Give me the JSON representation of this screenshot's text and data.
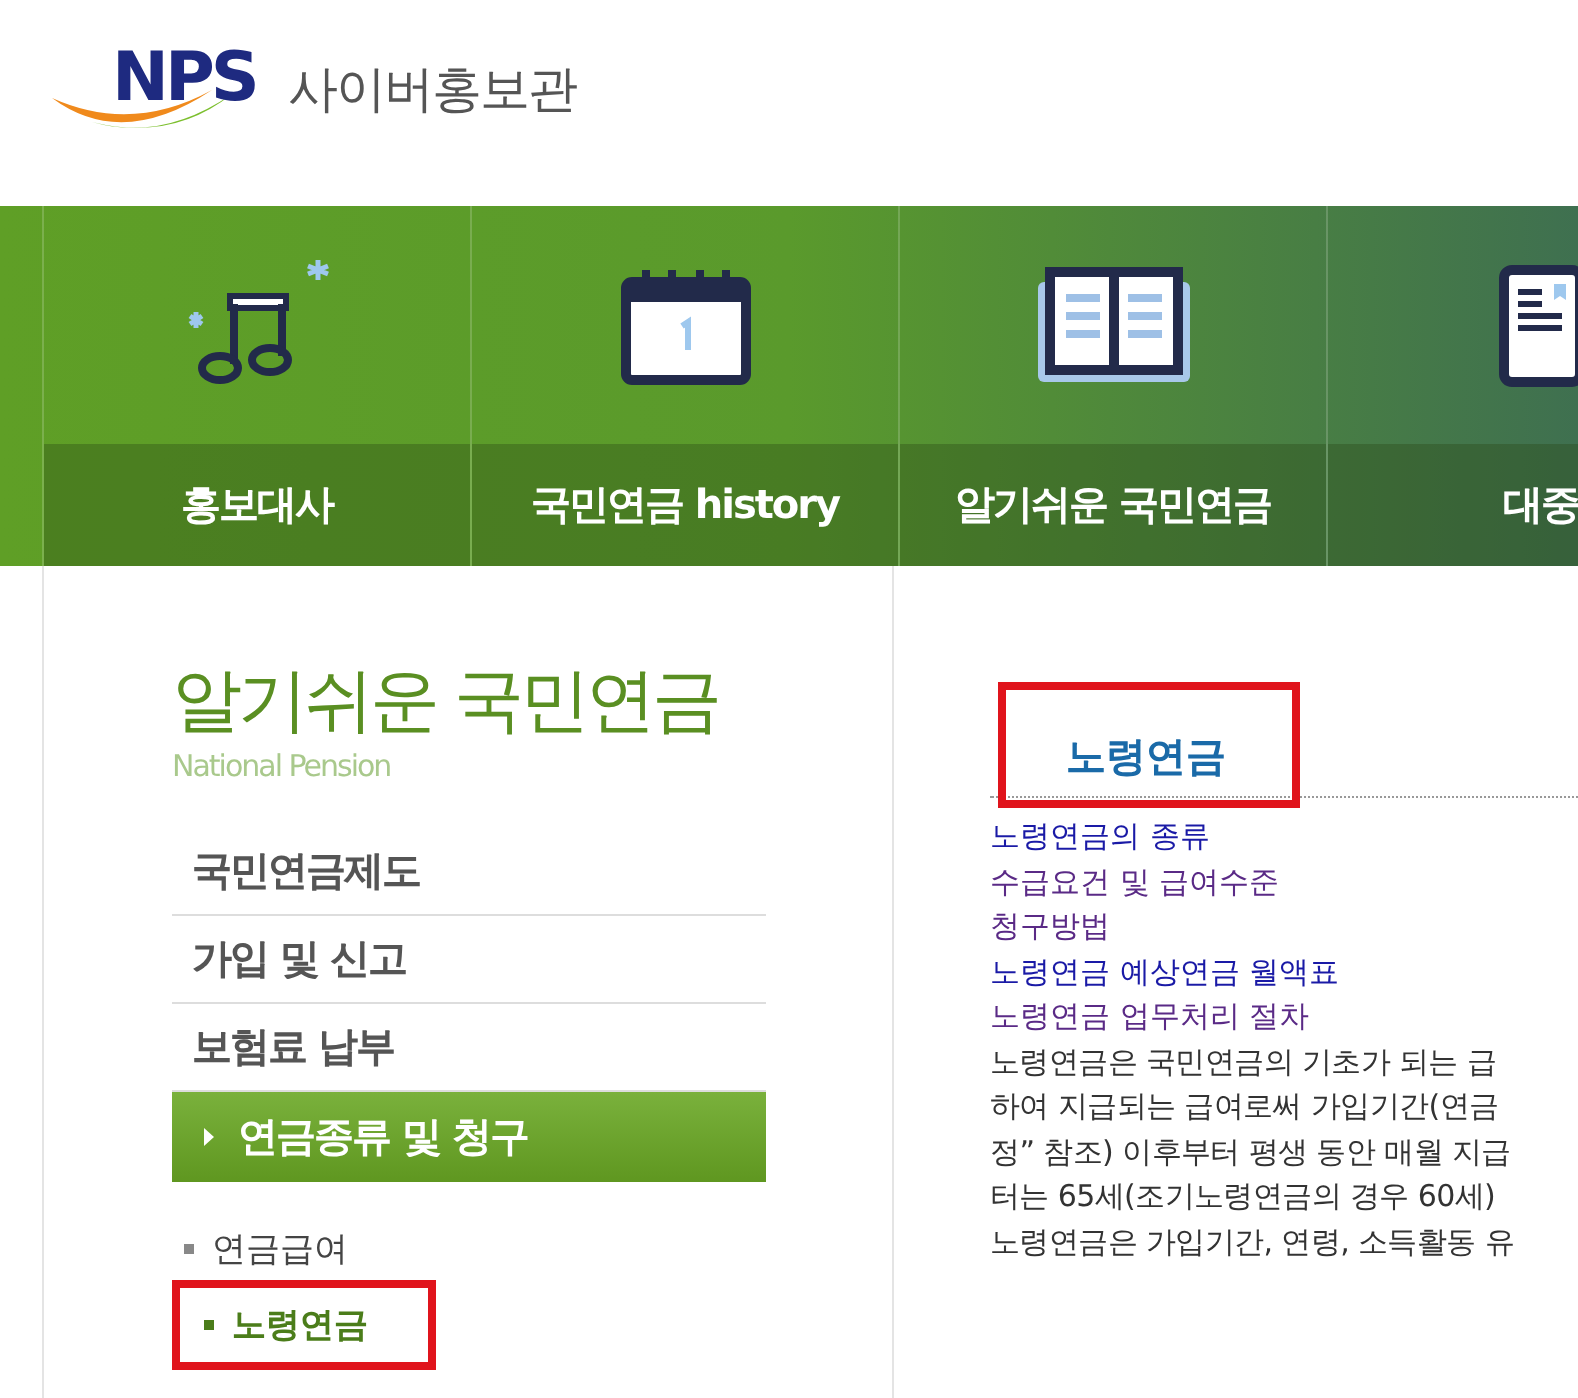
{
  "logo": {
    "mark": "NPS",
    "title": "사이버홍보관"
  },
  "nav": [
    {
      "label": "홍보대사",
      "kind": "music"
    },
    {
      "label": "국민연금 history",
      "kind": "calendar"
    },
    {
      "label": "알기쉬운 국민연금",
      "kind": "book"
    },
    {
      "label": "대중",
      "kind": "tablet"
    }
  ],
  "sidebar": {
    "title": "알기쉬운 국민연금",
    "subtitle": "National Pension",
    "items": [
      {
        "label": "국민연금제도",
        "selected": false
      },
      {
        "label": "가입 및 신고",
        "selected": false
      },
      {
        "label": "보험료 납부",
        "selected": false
      },
      {
        "label": "연금종류 및 청구",
        "selected": true
      }
    ],
    "subitems": [
      {
        "label": "연금급여",
        "selected": false,
        "highlighted": false
      },
      {
        "label": "노령연금",
        "selected": true,
        "highlighted": true
      }
    ]
  },
  "content": {
    "heading": "노령연금",
    "heading_highlighted": true,
    "links": [
      {
        "label": "노령연금의 종류",
        "visited": false
      },
      {
        "label": "수급요건 및 급여수준",
        "visited": true
      },
      {
        "label": "청구방법",
        "visited": true
      },
      {
        "label": "노령연금 예상연금 월액표",
        "visited": false
      },
      {
        "label": "노령연금 업무처리 절차",
        "visited": true
      }
    ],
    "paragraph": [
      "노령연금은 국민연금의 기초가 되는 급",
      "하여 지급되는 급여로써 가입기간(연금",
      "정” 참조) 이후부터 평생 동안 매월 지급",
      "터는 65세(조기노령연금의 경우 60세)",
      "노령연금은 가입기간, 연령, 소득활동 유"
    ]
  }
}
